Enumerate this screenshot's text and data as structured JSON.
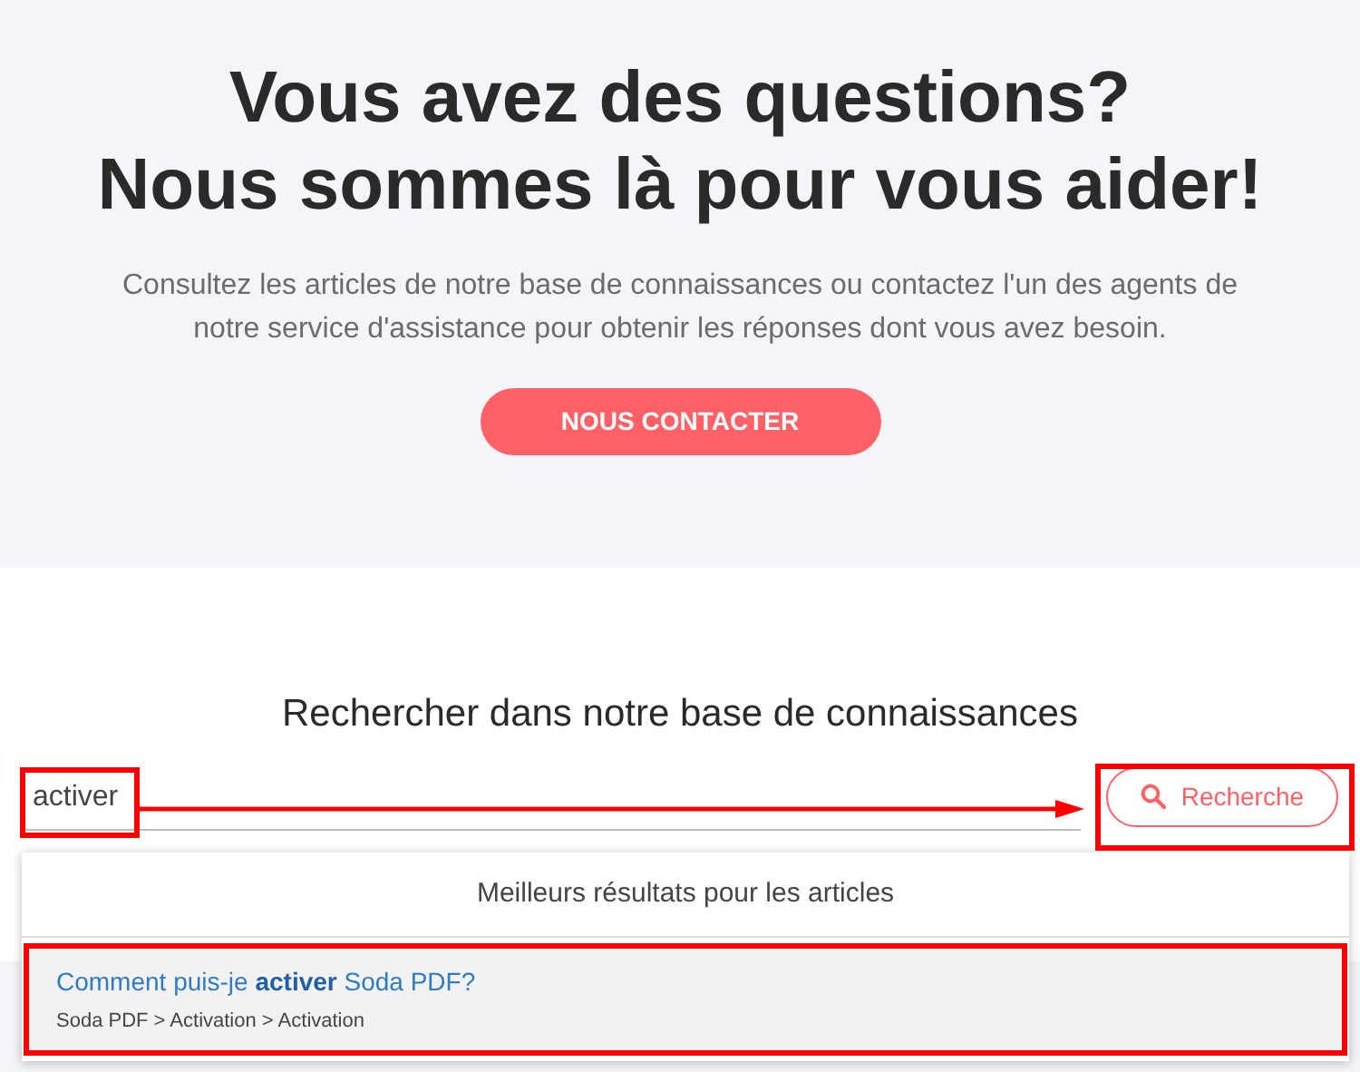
{
  "hero": {
    "title_line_1": "Vous avez des questions?",
    "title_line_2": "Nous sommes là pour vous aider!",
    "description": "Consultez les articles de notre base de connaissances ou contactez l'un des agents de notre service d'assistance pour obtenir les réponses dont vous avez besoin.",
    "button": "NOUS CONTACTER"
  },
  "search": {
    "heading": "Rechercher dans notre base de connaissances",
    "value": "activer",
    "button": "Recherche"
  },
  "results": {
    "header": "Meilleurs résultats pour les articles",
    "items": [
      {
        "title": "Comment puis-je **activer** Soda PDF?",
        "breadcrumb": "Soda PDF > Activation > Activation"
      }
    ]
  }
}
